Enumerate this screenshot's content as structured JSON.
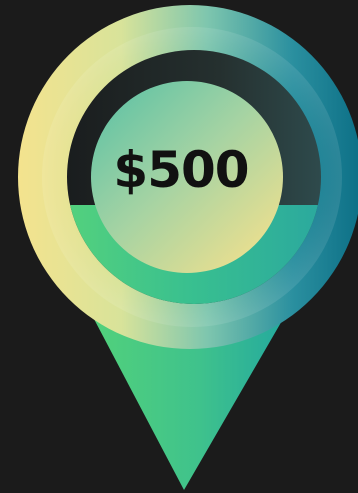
{
  "pin": {
    "amount": "$500",
    "icon": "map-pin-icon",
    "colors": {
      "background": "#1b1b1b",
      "yellow": "#f3e08e",
      "green": "#4fcf7e",
      "teal": "#2ab3a4",
      "deep_teal": "#0e7a8a",
      "dark_ring": "#1f2628",
      "text": "#111111"
    }
  }
}
